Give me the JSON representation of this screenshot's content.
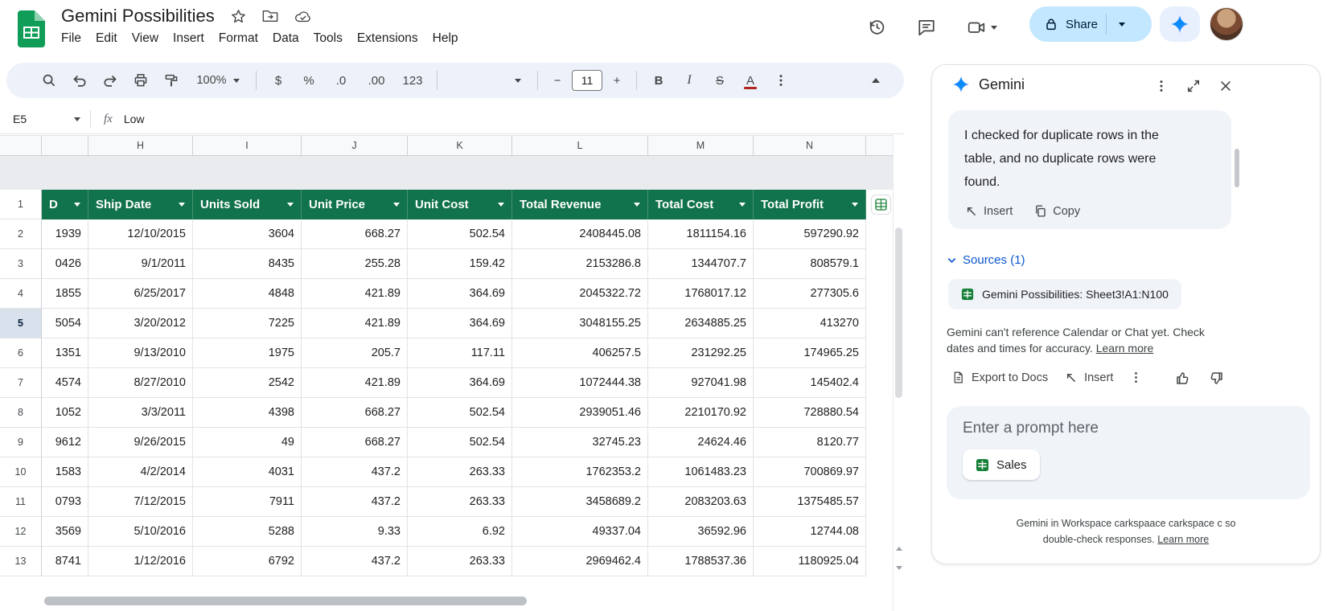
{
  "titlebar": {
    "title": "Gemini Possibilities",
    "menus": [
      "File",
      "Edit",
      "View",
      "Insert",
      "Format",
      "Data",
      "Tools",
      "Extensions",
      "Help"
    ],
    "share_label": "Share"
  },
  "toolbar": {
    "zoom": "100%",
    "currency_label": "$",
    "percent_label": "%",
    "decrease_decimal_label": ".0",
    "increase_decimal_label": ".00",
    "more_formats_label": "123",
    "font_size": "11",
    "bold_label": "B",
    "italic_label": "I",
    "strikethrough_label": "S",
    "text_color_label": "A"
  },
  "formula_bar": {
    "name_box": "E5",
    "fx_label": "fx",
    "value": "Low"
  },
  "sheet": {
    "column_letters": [
      "",
      "H",
      "I",
      "J",
      "K",
      "L",
      "M",
      "N"
    ],
    "header_row_number": "1",
    "header_labels": [
      "D",
      "Ship Date",
      "Units Sold",
      "Unit Price",
      "Unit Cost",
      "Total Revenue",
      "Total Cost",
      "Total Profit"
    ],
    "selected_row": "5",
    "rows": [
      {
        "num": "2",
        "cells": [
          "1939",
          "12/10/2015",
          "3604",
          "668.27",
          "502.54",
          "2408445.08",
          "1811154.16",
          "597290.92"
        ]
      },
      {
        "num": "3",
        "cells": [
          "0426",
          "9/1/2011",
          "8435",
          "255.28",
          "159.42",
          "2153286.8",
          "1344707.7",
          "808579.1"
        ]
      },
      {
        "num": "4",
        "cells": [
          "1855",
          "6/25/2017",
          "4848",
          "421.89",
          "364.69",
          "2045322.72",
          "1768017.12",
          "277305.6"
        ]
      },
      {
        "num": "5",
        "cells": [
          "5054",
          "3/20/2012",
          "7225",
          "421.89",
          "364.69",
          "3048155.25",
          "2634885.25",
          "413270"
        ]
      },
      {
        "num": "6",
        "cells": [
          "1351",
          "9/13/2010",
          "1975",
          "205.7",
          "117.11",
          "406257.5",
          "231292.25",
          "174965.25"
        ]
      },
      {
        "num": "7",
        "cells": [
          "4574",
          "8/27/2010",
          "2542",
          "421.89",
          "364.69",
          "1072444.38",
          "927041.98",
          "145402.4"
        ]
      },
      {
        "num": "8",
        "cells": [
          "1052",
          "3/3/2011",
          "4398",
          "668.27",
          "502.54",
          "2939051.46",
          "2210170.92",
          "728880.54"
        ]
      },
      {
        "num": "9",
        "cells": [
          "9612",
          "9/26/2015",
          "49",
          "668.27",
          "502.54",
          "32745.23",
          "24624.46",
          "8120.77"
        ]
      },
      {
        "num": "10",
        "cells": [
          "1583",
          "4/2/2014",
          "4031",
          "437.2",
          "263.33",
          "1762353.2",
          "1061483.23",
          "700869.97"
        ]
      },
      {
        "num": "11",
        "cells": [
          "0793",
          "7/12/2015",
          "7911",
          "437.2",
          "263.33",
          "3458689.2",
          "2083203.63",
          "1375485.57"
        ]
      },
      {
        "num": "12",
        "cells": [
          "3569",
          "5/10/2016",
          "5288",
          "9.33",
          "6.92",
          "49337.04",
          "36592.96",
          "12744.08"
        ]
      },
      {
        "num": "13",
        "cells": [
          "8741",
          "1/12/2016",
          "6792",
          "437.2",
          "263.33",
          "2969462.4",
          "1788537.36",
          "1180925.04"
        ]
      }
    ]
  },
  "gemini": {
    "title": "Gemini",
    "response_text": "I checked for duplicate rows in the table, and no duplicate rows were found.",
    "insert_label": "Insert",
    "copy_label": "Copy",
    "sources_label": "Sources (1)",
    "source_chip": "Gemini Possibilities: Sheet3!A1:N100",
    "disclaimer": "Gemini can't reference Calendar or Chat yet. Check dates and times for accuracy.",
    "disclaimer_link": "Learn more",
    "export_docs_label": "Export to Docs",
    "insert_action_label": "Insert",
    "prompt_placeholder": "Enter a prompt here",
    "suggestion_chip": "Sales",
    "footer_text": "Gemini in Workspace carkspaace carkspace c so double-check responses.",
    "footer_link": "Learn more"
  }
}
